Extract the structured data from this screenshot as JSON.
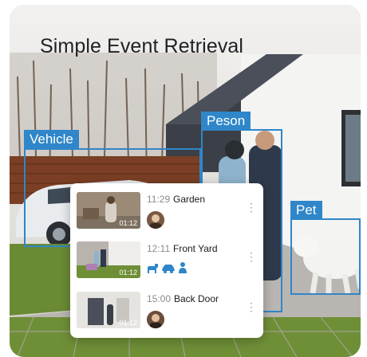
{
  "banner": {
    "title": "Simple Event Retrieval"
  },
  "detections": {
    "vehicle": "Vehicle",
    "person": "Peson",
    "pet": "Pet"
  },
  "events": [
    {
      "time": "11:29",
      "location": "Garden",
      "duration": "01:12",
      "tags": [
        "face-icon"
      ]
    },
    {
      "time": "12:11",
      "location": "Front Yard",
      "duration": "01:12",
      "tags": [
        "pet-icon",
        "vehicle-icon",
        "person-icon"
      ]
    },
    {
      "time": "15:00",
      "location": "Back Door",
      "duration": "01:12",
      "tags": [
        "face-icon"
      ]
    }
  ],
  "colors": {
    "accent": "#2f86c9",
    "panel": "#ffffff",
    "title": "#1e2024"
  }
}
